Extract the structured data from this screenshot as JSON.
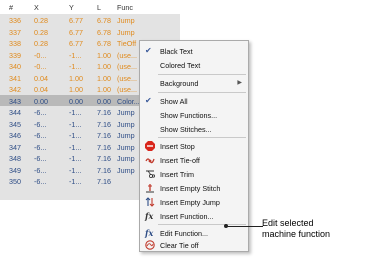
{
  "grid": {
    "headers": [
      "#",
      "X",
      "Y",
      "L",
      "Func"
    ],
    "rows": [
      {
        "cells": [
          "336",
          "0.28",
          "6.77",
          "6.78",
          "Jump"
        ],
        "color": "orange"
      },
      {
        "cells": [
          "337",
          "0.28",
          "6.77",
          "6.78",
          "Jump"
        ],
        "color": "orange"
      },
      {
        "cells": [
          "338",
          "0.28",
          "6.77",
          "6.78",
          "TieOff"
        ],
        "color": "orange"
      },
      {
        "cells": [
          "339",
          "-0...",
          "-1...",
          "1.00",
          "(use..."
        ],
        "color": "orange"
      },
      {
        "cells": [
          "340",
          "-0...",
          "-1...",
          "1.00",
          "(use..."
        ],
        "color": "orange"
      },
      {
        "cells": [
          "341",
          "0.04",
          "1.00",
          "1.00",
          "(use..."
        ],
        "color": "orange"
      },
      {
        "cells": [
          "342",
          "0.04",
          "1.00",
          "1.00",
          "(use..."
        ],
        "color": "orange"
      },
      {
        "cells": [
          "343",
          "0.00",
          "0.00",
          "0.00",
          "Color..."
        ],
        "color": "blue"
      },
      {
        "cells": [
          "344",
          "-6...",
          "-1...",
          "7.16",
          "Jump"
        ],
        "color": "blue"
      },
      {
        "cells": [
          "345",
          "-6...",
          "-1...",
          "7.16",
          "Jump"
        ],
        "color": "blue"
      },
      {
        "cells": [
          "346",
          "-6...",
          "-1...",
          "7.16",
          "Jump"
        ],
        "color": "blue"
      },
      {
        "cells": [
          "347",
          "-6...",
          "-1...",
          "7.16",
          "Jump"
        ],
        "color": "blue"
      },
      {
        "cells": [
          "348",
          "-6...",
          "-1...",
          "7.16",
          "Jump"
        ],
        "color": "blue"
      },
      {
        "cells": [
          "349",
          "-6...",
          "-1...",
          "7.16",
          "Jump"
        ],
        "color": "blue"
      },
      {
        "cells": [
          "350",
          "-6...",
          "-1...",
          "7.16",
          ""
        ],
        "color": "blue"
      }
    ]
  },
  "menu": {
    "black_text": "Black Text",
    "colored_text": "Colored Text",
    "background": "Background",
    "show_all": "Show All",
    "show_functions": "Show Functions...",
    "show_stitches": "Show Stitches...",
    "insert_stop": "Insert Stop",
    "insert_tie_off": "Insert Tie-off",
    "insert_trim": "Insert Trim",
    "insert_empty_stitch": "Insert Empty Stitch",
    "insert_empty_jump": "Insert Empty Jump",
    "insert_function": "Insert Function...",
    "edit_function": "Edit Function...",
    "clear_tie_off": "Clear Tie off"
  },
  "icons": {
    "check": "check-icon",
    "submenu": "submenu-arrow-icon",
    "stop": "stop-icon",
    "tie_off": "tie-off-icon",
    "trim": "trim-icon",
    "empty_stitch": "empty-stitch-icon",
    "empty_jump": "empty-jump-icon",
    "function": "function-icon",
    "edit_function": "edit-function-icon",
    "clear_tie_off": "clear-tie-off-icon"
  },
  "callout": {
    "line1": "Edit selected",
    "line2": "machine function"
  },
  "colors": {
    "orange_text": "#e08a1c",
    "blue_text": "#2e4d86",
    "grid_bg": "#e3e3e3",
    "highlight_row": "#b9b9b9",
    "stop_icon": "#d9261c"
  }
}
